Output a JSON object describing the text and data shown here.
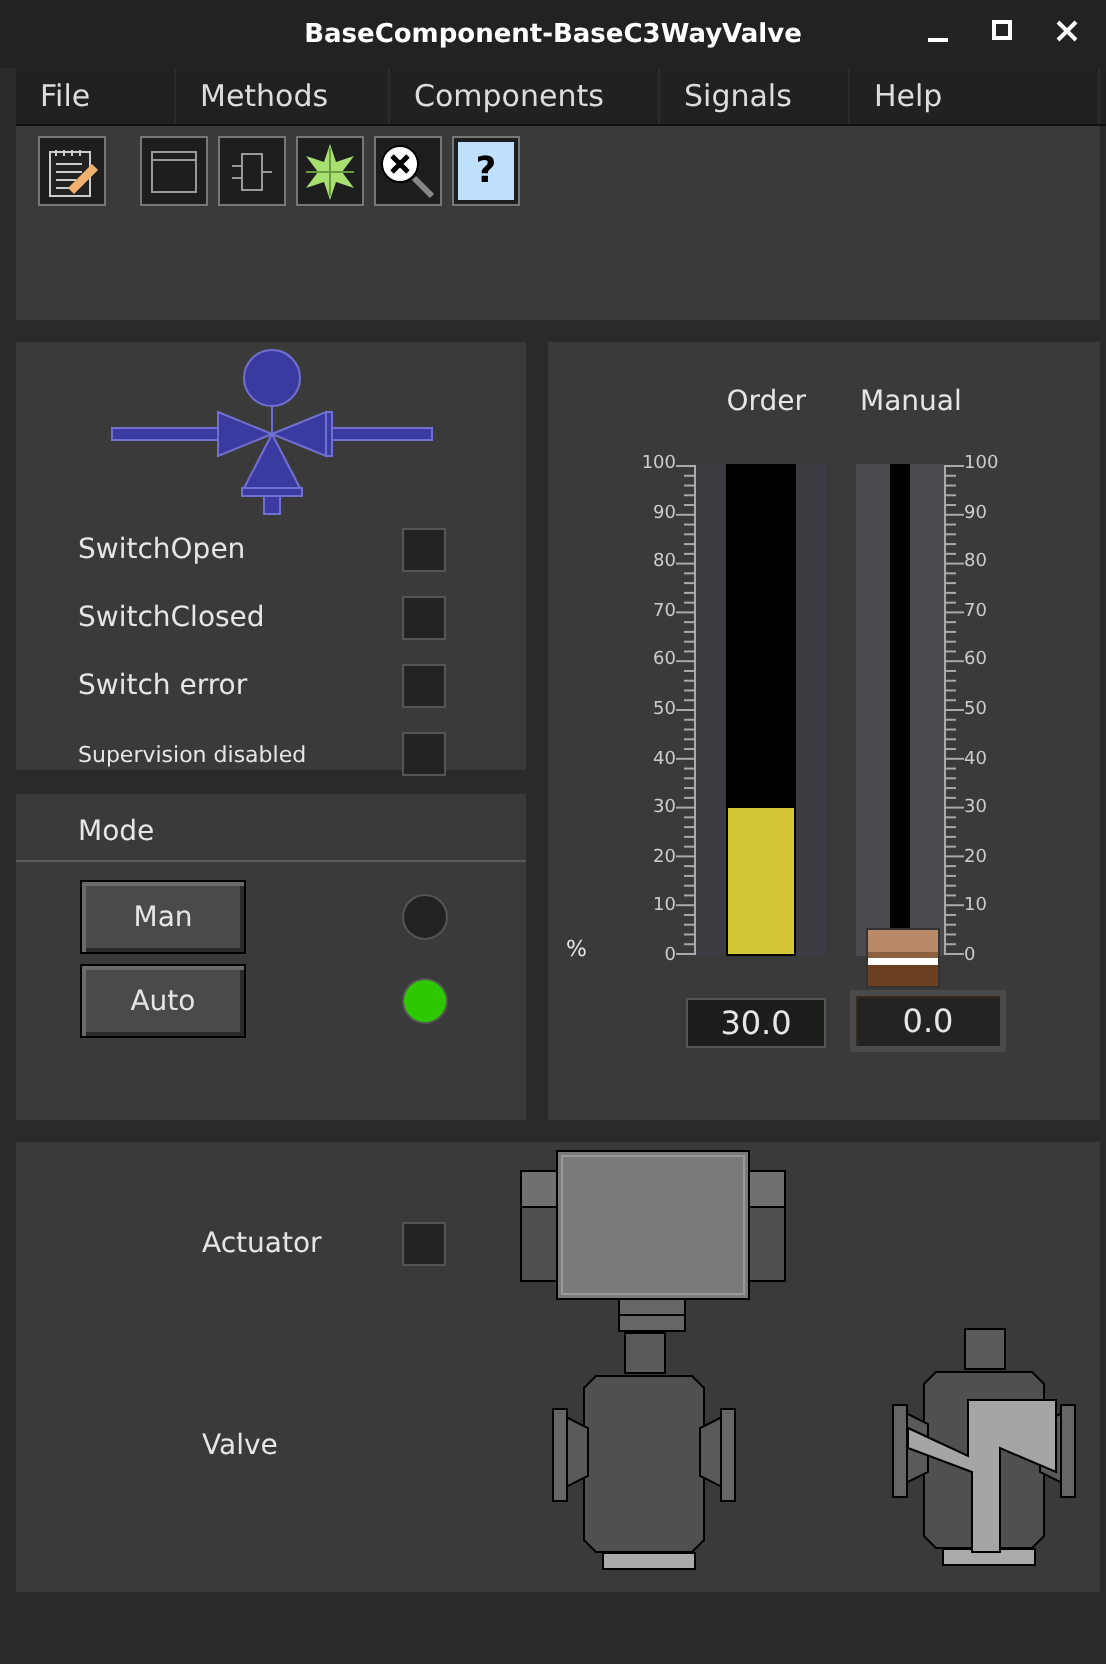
{
  "window": {
    "title": "BaseComponent-BaseC3WayValve"
  },
  "menu": [
    "File",
    "Methods",
    "Components",
    "Signals",
    "Help"
  ],
  "toolbar": [
    {
      "kind": "notepad"
    },
    {
      "kind": "window"
    },
    {
      "kind": "component"
    },
    {
      "kind": "burst"
    },
    {
      "kind": "zoom-reset"
    },
    {
      "kind": "help",
      "label": "?"
    }
  ],
  "status": [
    {
      "label": "SwitchOpen",
      "on": false,
      "compact": false
    },
    {
      "label": "SwitchClosed",
      "on": false,
      "compact": false
    },
    {
      "label": "Switch error",
      "on": false,
      "compact": false
    },
    {
      "label": "Supervision disabled",
      "on": false,
      "compact": true
    }
  ],
  "mode": {
    "title": "Mode",
    "buttons": [
      {
        "label": "Man",
        "on": false
      },
      {
        "label": "Auto",
        "on": true
      }
    ]
  },
  "meters": {
    "unit": "%",
    "order": {
      "label": "Order",
      "level": 0.3,
      "value": "30.0",
      "ticks": [
        "100",
        "90",
        "80",
        "70",
        "60",
        "50",
        "40",
        "30",
        "20",
        "10",
        "0"
      ]
    },
    "manual": {
      "label": "Manual",
      "level": 0,
      "value": "0.0",
      "ticks": [
        "100",
        "90",
        "80",
        "70",
        "60",
        "50",
        "40",
        "30",
        "20",
        "10",
        "0"
      ]
    }
  },
  "plant": {
    "actuator": {
      "label": "Actuator",
      "on": false
    },
    "valve": {
      "label": "Valve"
    }
  }
}
